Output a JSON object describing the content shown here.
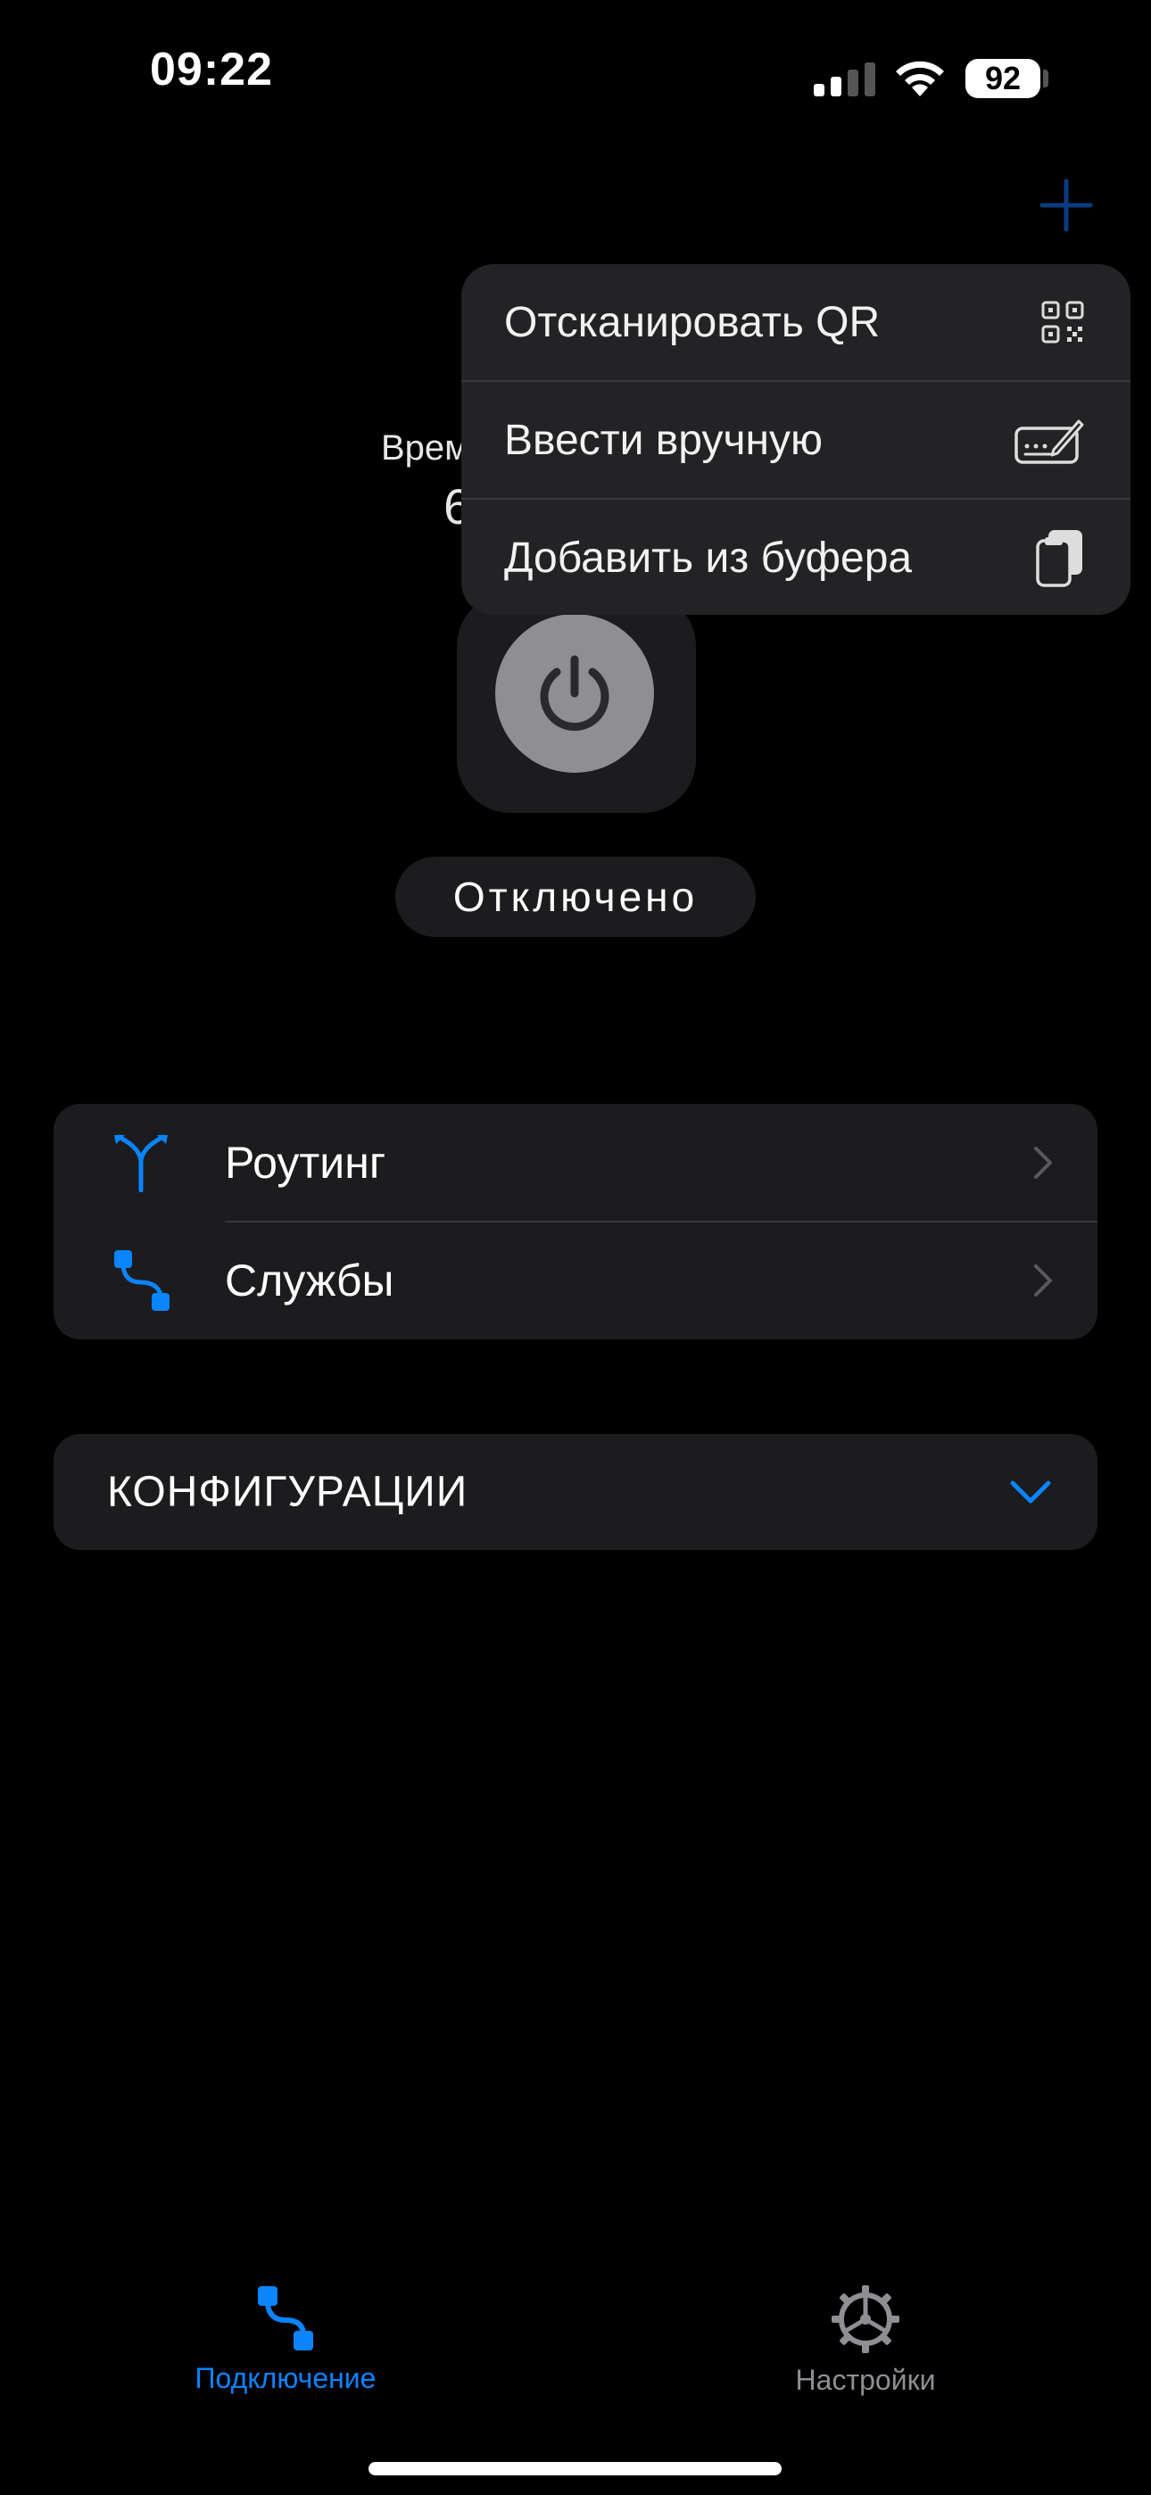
{
  "status_bar": {
    "time": "09:22",
    "battery": "92"
  },
  "background": {
    "label_fragment": "Врем",
    "value_fragment": "6"
  },
  "menu": {
    "items": [
      {
        "label": "Отсканировать QR",
        "icon": "qr-code-icon"
      },
      {
        "label": "Ввести вручную",
        "icon": "keyboard-pencil-icon"
      },
      {
        "label": "Добавить из буфера",
        "icon": "clipboard-icon"
      }
    ]
  },
  "connection": {
    "status": "Отключено"
  },
  "list": {
    "items": [
      {
        "label": "Роутинг",
        "icon": "routing-fork-icon"
      },
      {
        "label": "Службы",
        "icon": "services-path-icon"
      }
    ]
  },
  "configs": {
    "label": "КОНФИГУРАЦИИ"
  },
  "tabs": [
    {
      "label": "Подключение",
      "icon": "connection-icon",
      "active": true
    },
    {
      "label": "Настройки",
      "icon": "gear-icon",
      "active": false
    }
  ],
  "colors": {
    "accent": "#0a84ff",
    "background": "#000000",
    "card": "#1c1c1e",
    "menu": "#232325",
    "inactive": "#8e8e93"
  }
}
